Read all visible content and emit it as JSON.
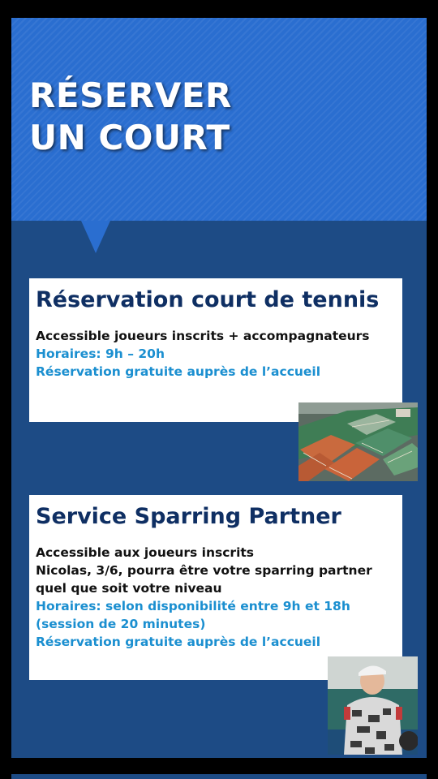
{
  "header": {
    "title_line1": "RÉSERVER",
    "title_line2": "UN COURT"
  },
  "cards": [
    {
      "title": "Réservation court de tennis",
      "lines": [
        {
          "text": "Accessible joueurs inscrits + accompagnateurs",
          "color": "#111111"
        },
        {
          "text": "Horaires: 9h – 20h",
          "color": "#1b8fd0"
        },
        {
          "text": "Réservation gratuite auprès de l’accueil",
          "color": "#1b8fd0"
        }
      ],
      "photo_icon": "tennis-courts-aerial-photo"
    },
    {
      "title": "Service Sparring Partner",
      "lines": [
        {
          "text": "Accessible aux joueurs inscrits",
          "color": "#111111"
        },
        {
          "text": "Nicolas, 3/6, pourra être votre sparring partner quel que soit votre niveau",
          "color": "#111111"
        },
        {
          "text": "Horaires: selon disponibilité entre 9h et 18h (session de 20 minutes)",
          "color": "#1b8fd0"
        },
        {
          "text": "Réservation gratuite auprès de l’accueil",
          "color": "#1b8fd0"
        }
      ],
      "photo_icon": "player-portrait-photo"
    }
  ],
  "colors": {
    "header_blue": "#2a6ed0",
    "panel_navy": "#1d4b85",
    "title_navy": "#0f2f63",
    "accent_blue": "#1b8fd0"
  }
}
